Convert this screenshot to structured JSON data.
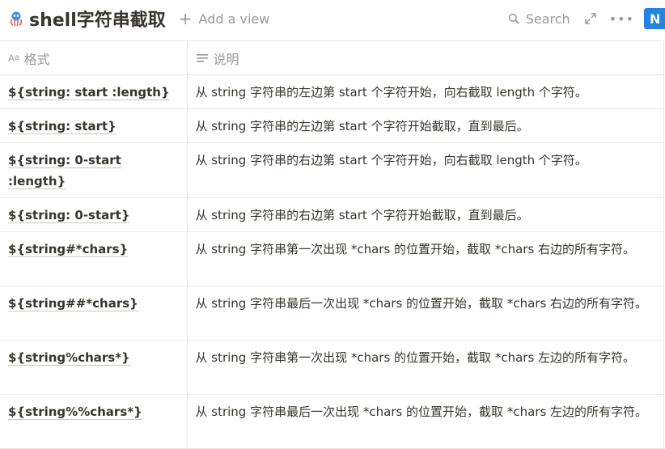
{
  "page": {
    "title": "shell字符串截取",
    "icon": "octopus-icon",
    "add_view": "Add a view",
    "search": "Search",
    "new_button": "N"
  },
  "table": {
    "columns": [
      {
        "label": "格式",
        "icon": "text-aa-icon"
      },
      {
        "label": "说明",
        "icon": "text-lines-icon"
      }
    ],
    "rows": [
      {
        "format": "${string: start :length}",
        "description": "从 string 字符串的左边第 start 个字符开始，向右截取 length 个字符。"
      },
      {
        "format": "${string: start}",
        "description": "从 string 字符串的左边第 start 个字符开始截取，直到最后。"
      },
      {
        "format": "${string: 0-start :length}",
        "description": "从 string 字符串的右边第 start 个字符开始，向右截取 length 个字符。"
      },
      {
        "format": "${string: 0-start}",
        "description": "从 string 字符串的右边第 start 个字符开始截取，直到最后。"
      },
      {
        "format": "${string#*chars}",
        "description": "从 string 字符串第一次出现 *chars 的位置开始，截取 *chars 右边的所有字符。"
      },
      {
        "format": "${string##*chars}",
        "description": "从 string 字符串最后一次出现 *chars 的位置开始，截取 *chars 右边的所有字符。"
      },
      {
        "format": "${string%chars*}",
        "description": "从 string 字符串第一次出现 *chars 的位置开始，截取 *chars 左边的所有字符。"
      },
      {
        "format": "${string%%chars*}",
        "description": "从 string 字符串最后一次出现 *chars 的位置开始，截取 *chars 左边的所有字符。"
      }
    ]
  },
  "colors": {
    "accent": "#2383e2",
    "text": "#37352f",
    "muted": "#9b9a97",
    "border": "#e9e9e7"
  }
}
